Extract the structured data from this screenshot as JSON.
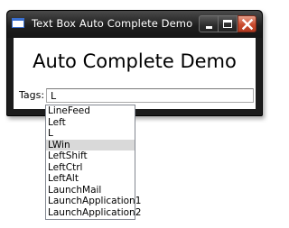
{
  "window": {
    "title": "Text Box Auto Complete Demo"
  },
  "main": {
    "heading": "Auto Complete Demo",
    "tags_label": "Tags:",
    "tags_value": "L"
  },
  "autocomplete": {
    "items": [
      "LineFeed",
      "Left",
      "L",
      "LWin",
      "LeftShift",
      "LeftCtrl",
      "LeftAlt",
      "LaunchMail",
      "LaunchApplication1",
      "LaunchApplication2"
    ],
    "highlighted_index": 3
  },
  "colors": {
    "titlebar": "#1e1e1e",
    "close_button": "#c94a2e",
    "highlight": "#d9d9d9"
  },
  "icons": [
    "app-window-icon",
    "minimize-icon",
    "maximize-icon",
    "close-icon"
  ]
}
